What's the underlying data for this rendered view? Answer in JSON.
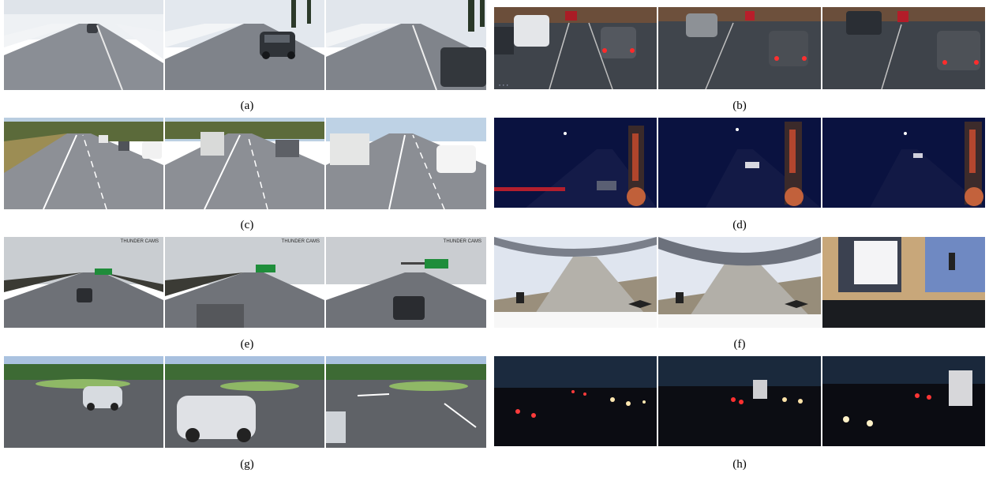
{
  "panels": [
    {
      "caption": "(a)",
      "scene": "snowy highway daytime"
    },
    {
      "caption": "(b)",
      "scene": "wet city traffic dusk"
    },
    {
      "caption": "(c)",
      "scene": "sunny multi-lane highway"
    },
    {
      "caption": "(d)",
      "scene": "night highway with truck mirror"
    },
    {
      "caption": "(e)",
      "scene": "snowy highway with green signs",
      "watermark": "THUNDER CAMS"
    },
    {
      "caption": "(f)",
      "scene": "truck cab view highway"
    },
    {
      "caption": "(g)",
      "scene": "roundabout with hatchback"
    },
    {
      "caption": "(h)",
      "scene": "night traffic with lights"
    }
  ],
  "colors": {
    "snow": "#e6e9ee",
    "road_gray": "#7b7f86",
    "sky_day": "#c9d5e4",
    "night": "#0a1240",
    "grass": "#8c8a3a",
    "wet_road": "#3b3f45"
  }
}
